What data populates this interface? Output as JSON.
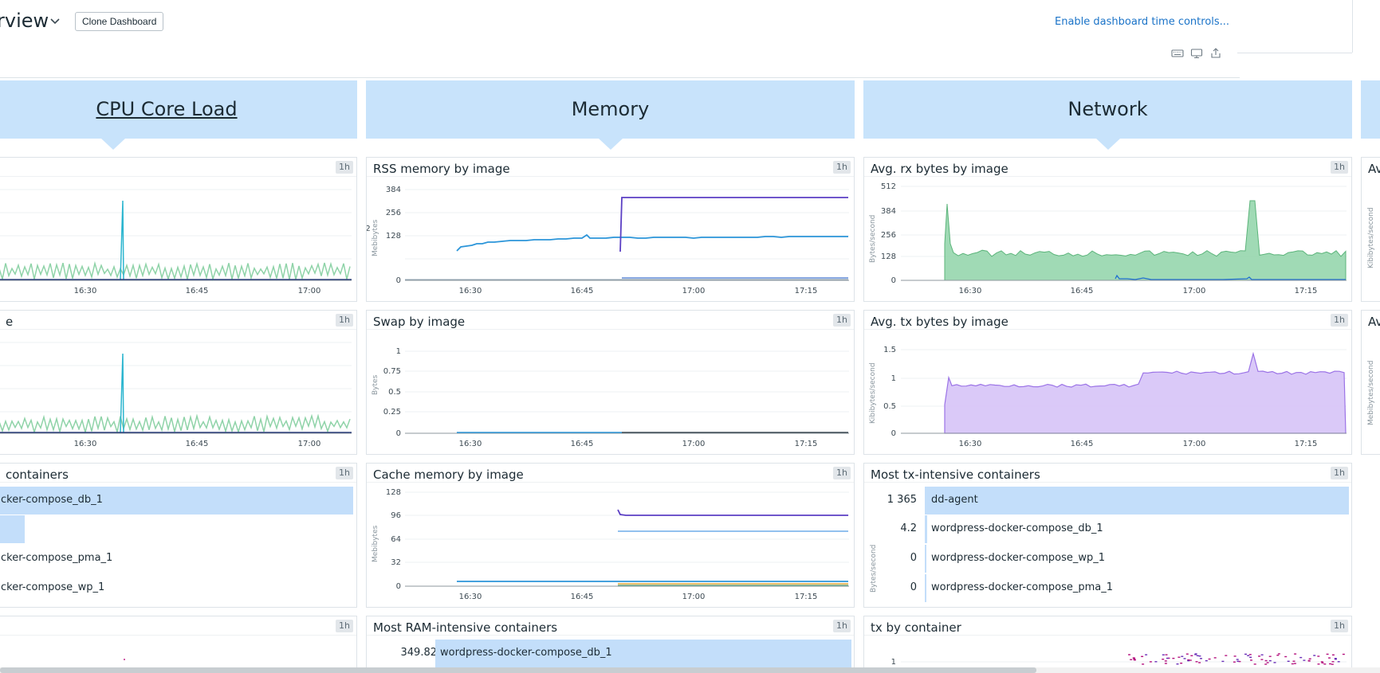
{
  "header": {
    "title": "rview",
    "clone_label": "Clone Dashboard",
    "time_controls_link": "Enable dashboard time controls..."
  },
  "groups": [
    {
      "title": "CPU Core Load"
    },
    {
      "title": "Memory"
    },
    {
      "title": "Network"
    }
  ],
  "badge": "1h",
  "time_ticks": [
    "16:30",
    "16:45",
    "17:00",
    "17:15"
  ],
  "widgets": {
    "cpu1": {
      "title": ""
    },
    "cpu2": {
      "title": "e"
    },
    "cpu3": {
      "title": "containers",
      "rows": [
        {
          "label": "cker-compose_db_1",
          "fill": 1.0
        },
        {
          "label": "",
          "fill": 0.07
        },
        {
          "label": "cker-compose_pma_1",
          "fill": 0
        },
        {
          "label": "cker-compose_wp_1",
          "fill": 0
        }
      ]
    },
    "cpu4": {
      "title": ""
    },
    "rss": {
      "title": "RSS memory by image",
      "unit": "Mebibytes",
      "yticks": [
        "384",
        "256",
        "128",
        "0"
      ],
      "side_label": "02"
    },
    "swap": {
      "title": "Swap by image",
      "unit": "Bytes",
      "yticks": [
        "1",
        "0.75",
        "0.5",
        "0.25",
        "0"
      ]
    },
    "cache": {
      "title": "Cache memory by image",
      "unit": "Mebibytes",
      "yticks": [
        "128",
        "96",
        "64",
        "32",
        "0"
      ]
    },
    "ram": {
      "title": "Most RAM-intensive containers",
      "rows": [
        {
          "value": "349.82",
          "label": "wordpress-docker-compose_db_1",
          "fill": 1.0
        }
      ]
    },
    "rx": {
      "title": "Avg. rx bytes by image",
      "unit": "Bytes/second",
      "yticks": [
        "512",
        "384",
        "256",
        "128",
        "0"
      ]
    },
    "tx": {
      "title": "Avg. tx bytes by image",
      "unit": "Kibibytes/second",
      "yticks": [
        "1.5",
        "1",
        "0.5",
        "0"
      ]
    },
    "txcont": {
      "title": "Most tx-intensive containers",
      "unit": "Bytes/second",
      "rows": [
        {
          "value": "1 365",
          "label": "dd-agent",
          "fill": 1.0
        },
        {
          "value": "4.2",
          "label": "wordpress-docker-compose_db_1",
          "fill": 0.004
        },
        {
          "value": "0",
          "label": "wordpress-docker-compose_wp_1",
          "fill": 0
        },
        {
          "value": "0",
          "label": "wordpress-docker-compose_pma_1",
          "fill": 0
        }
      ]
    },
    "txby": {
      "title": "tx by container",
      "yticks": [
        "1"
      ]
    },
    "right1": {
      "title": "Av",
      "unit": "Kibibytes/second"
    },
    "right2": {
      "title": "Av",
      "unit": "Mebibytes/second"
    }
  },
  "colors": {
    "group_bg": "#c8e3fb",
    "bar_fill": "#c3defa",
    "link": "#1a73c8",
    "green_series": "#8fd3a8",
    "purple_series": "#d6c3f7",
    "blue_line": "#2b95d9",
    "indigo_line": "#5b3fc4"
  }
}
